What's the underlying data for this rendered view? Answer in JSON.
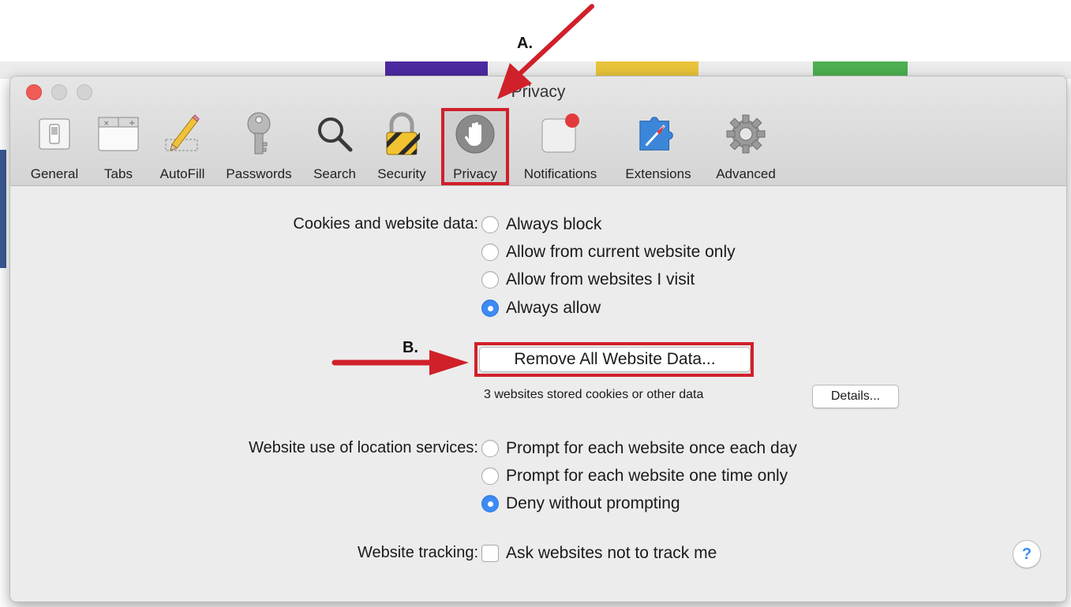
{
  "window": {
    "title": "Privacy"
  },
  "toolbar": {
    "tabs": [
      {
        "label": "General",
        "icon": "general-switch-icon"
      },
      {
        "label": "Tabs",
        "icon": "tabs-icon"
      },
      {
        "label": "AutoFill",
        "icon": "pencil-icon"
      },
      {
        "label": "Passwords",
        "icon": "key-icon"
      },
      {
        "label": "Search",
        "icon": "magnifier-icon"
      },
      {
        "label": "Security",
        "icon": "padlock-icon"
      },
      {
        "label": "Privacy",
        "icon": "hand-icon",
        "selected": true
      },
      {
        "label": "Notifications",
        "icon": "notification-badge-icon"
      },
      {
        "label": "Extensions",
        "icon": "puzzle-compass-icon"
      },
      {
        "label": "Advanced",
        "icon": "gear-icon"
      }
    ]
  },
  "cookies": {
    "label": "Cookies and website data:",
    "options": [
      {
        "text": "Always block",
        "selected": false
      },
      {
        "text": "Allow from current website only",
        "selected": false
      },
      {
        "text": "Allow from websites I visit",
        "selected": false
      },
      {
        "text": "Always allow",
        "selected": true
      }
    ],
    "remove_button": "Remove All Website Data...",
    "stored_text": "3 websites stored cookies or other data",
    "details_button": "Details..."
  },
  "location": {
    "label": "Website use of location services:",
    "options": [
      {
        "text": "Prompt for each website once each day",
        "selected": false
      },
      {
        "text": "Prompt for each website one time only",
        "selected": false
      },
      {
        "text": "Deny without prompting",
        "selected": true
      }
    ]
  },
  "tracking": {
    "label": "Website tracking:",
    "checkbox_text": "Ask websites not to track me",
    "checked": false
  },
  "help": {
    "label": "?"
  },
  "annotations": {
    "marker_a": "A.",
    "marker_b": "B.",
    "color": "#d0202a"
  },
  "colors": {
    "accent": "#3d8bf5",
    "close": "#ef5c55"
  }
}
